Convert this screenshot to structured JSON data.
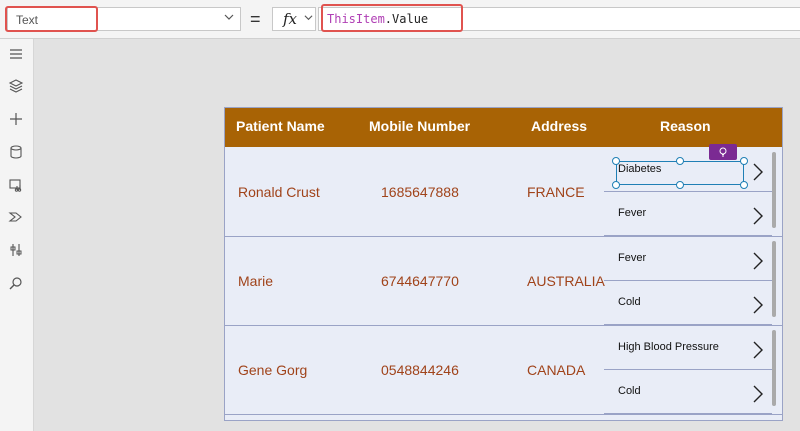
{
  "formula_bar": {
    "property": "Text",
    "equals": "=",
    "fx_label": "fx",
    "formula_keyword": "ThisItem",
    "formula_rest": ".Value"
  },
  "left_rail": {
    "icons": [
      "menu-icon",
      "layers-icon",
      "plus-icon",
      "database-icon",
      "media-icon",
      "power-automate-icon",
      "tools-icon",
      "search-icon"
    ]
  },
  "gallery": {
    "columns": [
      "Patient Name",
      "Mobile Number",
      "Address",
      "Reason"
    ],
    "header_color": "#a86305",
    "text_color": "#a0431a",
    "rows": [
      {
        "name": "Ronald Crust",
        "mobile": "1685647888",
        "address": "FRANCE",
        "reasons": [
          "Diabetes",
          "Fever"
        ]
      },
      {
        "name": "Marie",
        "mobile": "6744647770",
        "address": "AUSTRALIA",
        "reasons": [
          "Fever",
          "Cold"
        ]
      },
      {
        "name": "Gene Gorg",
        "mobile": "0548844246",
        "address": "CANADA",
        "reasons": [
          "High Blood Pressure",
          "Cold"
        ]
      }
    ]
  },
  "colors": {
    "highlight": "#e0534f",
    "selection": "#1f7fb5",
    "badge": "#7b2a93",
    "formula_keyword": "#b03fb5"
  }
}
